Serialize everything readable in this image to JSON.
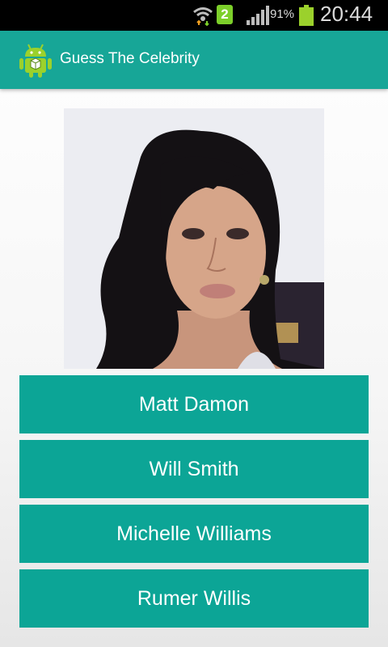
{
  "status_bar": {
    "notification_count": "2",
    "battery_percent": "91%",
    "time": "20:44",
    "icons": [
      "wifi-icon",
      "notification-icon",
      "signal-icon",
      "battery-icon"
    ]
  },
  "action_bar": {
    "title": "Guess The Celebrity",
    "icon": "android-app-icon",
    "color": "#17a697"
  },
  "celebrity_photo": {
    "icon": "celebrity-portrait"
  },
  "answers": [
    {
      "label": "Matt Damon"
    },
    {
      "label": "Will Smith"
    },
    {
      "label": "Michelle Williams"
    },
    {
      "label": "Rumer Willis"
    }
  ],
  "colors": {
    "button": "#0ca596",
    "button_text": "#ffffff"
  }
}
